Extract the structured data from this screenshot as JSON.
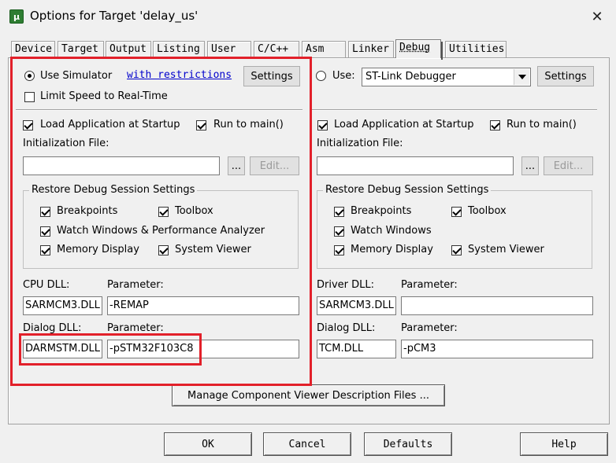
{
  "window": {
    "title": "Options for Target 'delay_us'",
    "app_icon": "µ",
    "close_glyph": "✕"
  },
  "tabs": [
    {
      "label": "Device",
      "active": false
    },
    {
      "label": "Target",
      "active": false
    },
    {
      "label": "Output",
      "active": false
    },
    {
      "label": "Listing",
      "active": false
    },
    {
      "label": "User",
      "active": false
    },
    {
      "label": "C/C++",
      "active": false
    },
    {
      "label": "Asm",
      "active": false
    },
    {
      "label": "Linker",
      "active": false
    },
    {
      "label": "Debug",
      "active": true
    },
    {
      "label": "Utilities",
      "active": false
    }
  ],
  "left": {
    "use_simulator": "Use Simulator",
    "restrictions_link": "with restrictions",
    "settings_btn": "Settings",
    "limit_speed": "Limit Speed to Real-Time",
    "load_app": "Load Application at Startup",
    "run_to_main": "Run to main()",
    "init_file_label": "Initialization File:",
    "init_file_value": "",
    "browse_btn": "...",
    "edit_btn": "Edit...",
    "restore_title": "Restore Debug Session Settings",
    "breakpoints": "Breakpoints",
    "toolbox": "Toolbox",
    "watch_windows": "Watch Windows & Performance Analyzer",
    "memory_display": "Memory Display",
    "system_viewer": "System Viewer",
    "cpu_dll_label": "CPU DLL:",
    "cpu_param_label": "Parameter:",
    "cpu_dll_value": "SARMCM3.DLL",
    "cpu_param_value": "-REMAP",
    "dialog_dll_label": "Dialog DLL:",
    "dialog_param_label": "Parameter:",
    "dialog_dll_value": "DARMSTM.DLL",
    "dialog_param_value": "-pSTM32F103C8"
  },
  "right": {
    "use_label": "Use:",
    "debugger_value": "ST-Link Debugger",
    "settings_btn": "Settings",
    "load_app": "Load Application at Startup",
    "run_to_main": "Run to main()",
    "init_file_label": "Initialization File:",
    "init_file_value": "",
    "browse_btn": "...",
    "edit_btn": "Edit...",
    "restore_title": "Restore Debug Session Settings",
    "breakpoints": "Breakpoints",
    "toolbox": "Toolbox",
    "watch_windows": "Watch Windows",
    "memory_display": "Memory Display",
    "system_viewer": "System Viewer",
    "driver_dll_label": "Driver DLL:",
    "driver_param_label": "Parameter:",
    "driver_dll_value": "SARMCM3.DLL",
    "driver_param_value": "",
    "dialog_dll_label": "Dialog DLL:",
    "dialog_param_label": "Parameter:",
    "dialog_dll_value": "TCM.DLL",
    "dialog_param_value": "-pCM3"
  },
  "manage_btn": "Manage Component Viewer Description Files ...",
  "footer": {
    "ok": "OK",
    "cancel": "Cancel",
    "defaults": "Defaults",
    "help": "Help"
  },
  "highlight_color": "#e2202a"
}
